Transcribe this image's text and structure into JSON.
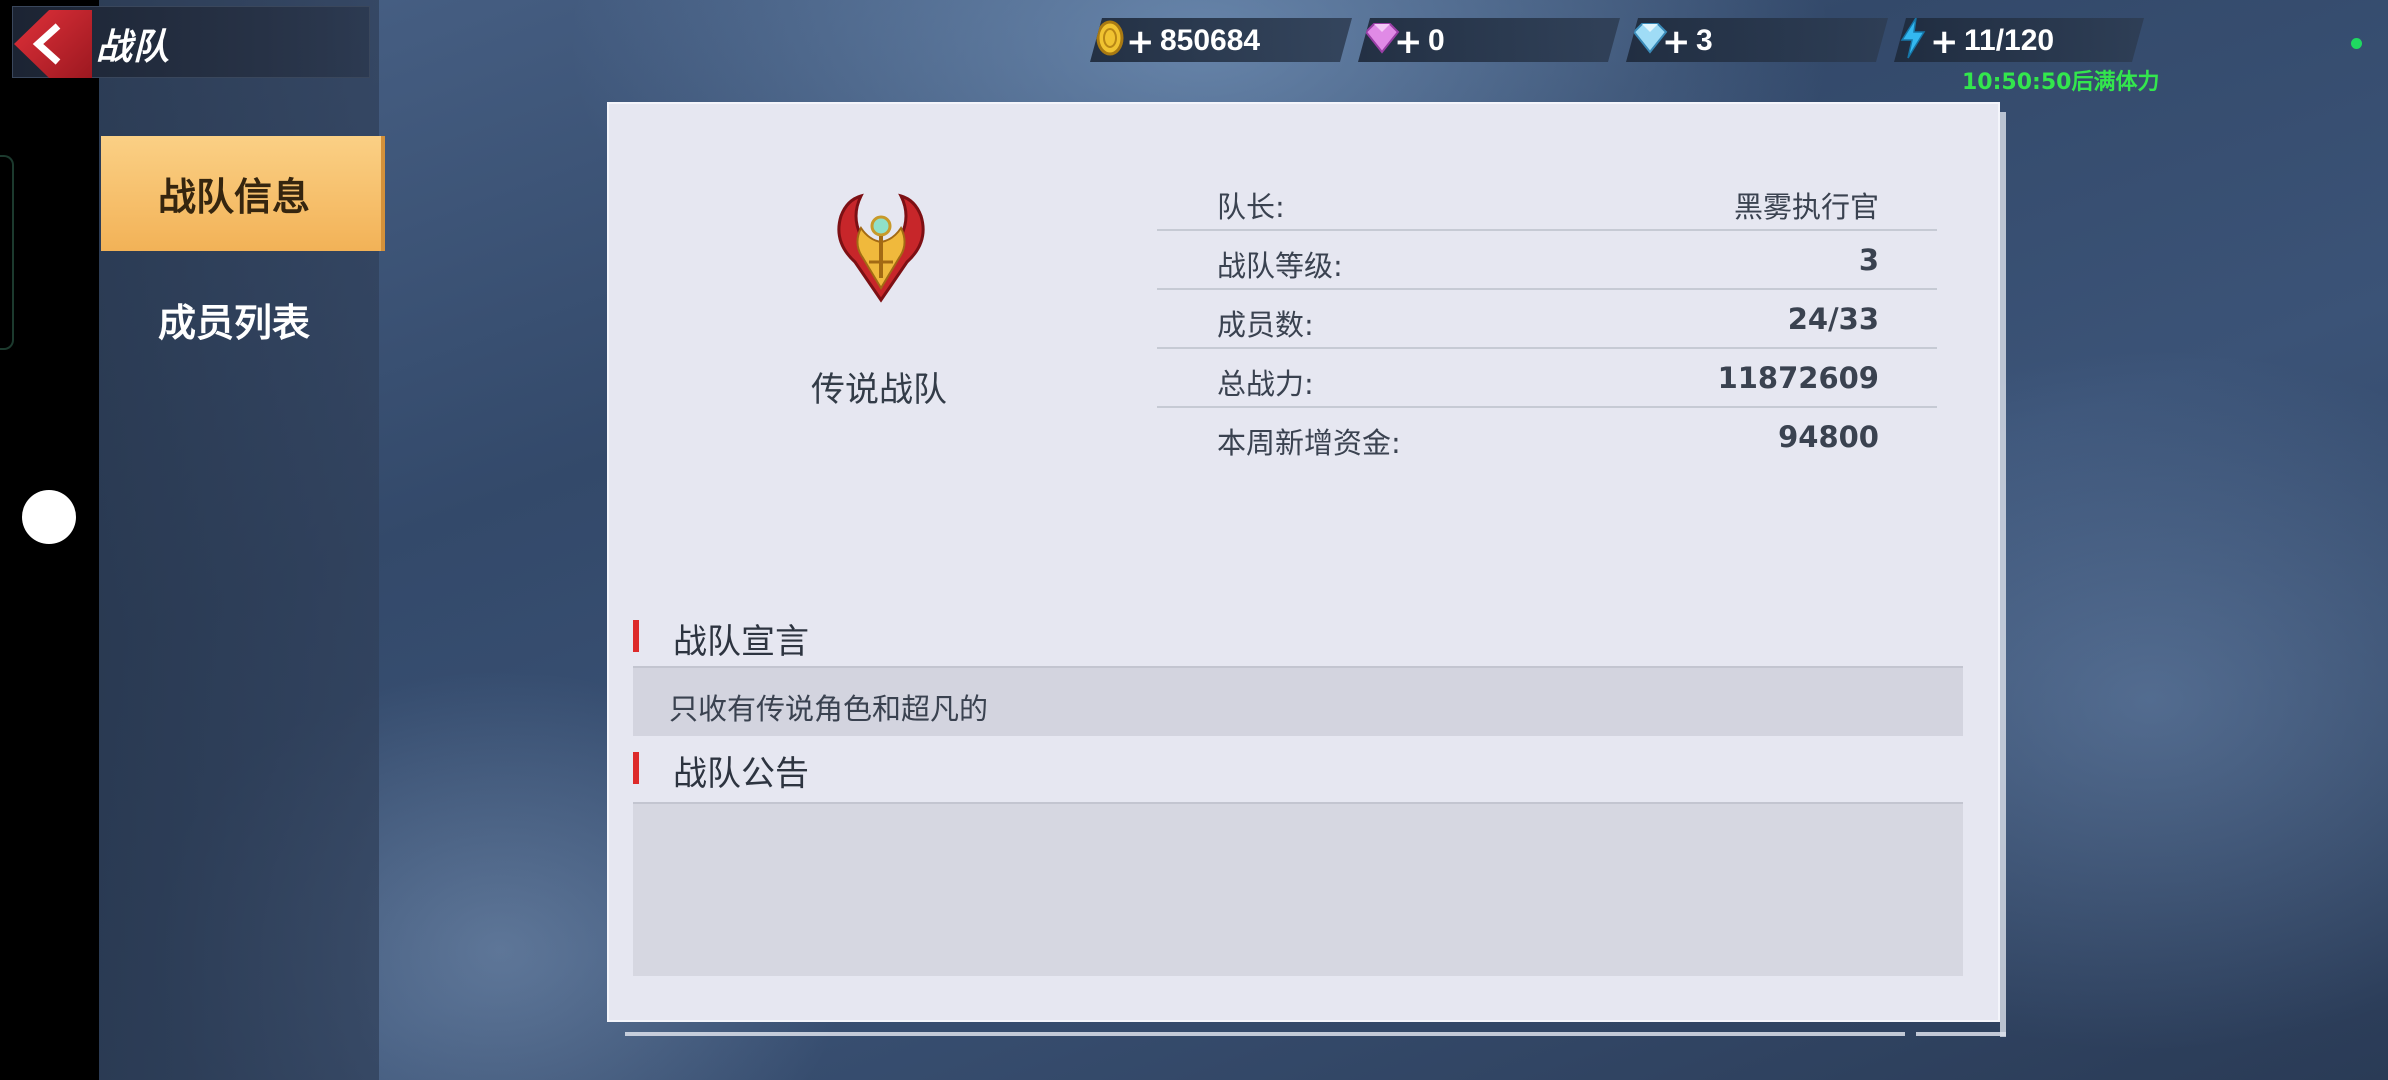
{
  "header": {
    "title": "战队"
  },
  "tabs": [
    {
      "label": "战队信息",
      "active": true
    },
    {
      "label": "成员列表",
      "active": false
    }
  ],
  "resources": {
    "gold": {
      "icon": "gold-coin-icon",
      "value": "850684"
    },
    "pink_gem": {
      "icon": "pink-diamond-icon",
      "value": "0"
    },
    "blue_gem": {
      "icon": "blue-diamond-icon",
      "value": "3"
    },
    "energy": {
      "icon": "lightning-icon",
      "value": "11/120"
    },
    "energy_timer": "10:50:50后满体力"
  },
  "team": {
    "name": "传说战队",
    "emblem": "team-emblem-icon",
    "info": [
      {
        "label": "队长:",
        "value": "黑雾执行官"
      },
      {
        "label": "战队等级:",
        "value": "3"
      },
      {
        "label": "成员数:",
        "value": "24/33"
      },
      {
        "label": "总战力:",
        "value": "11872609"
      },
      {
        "label": "本周新增资金:",
        "value": "94800"
      }
    ]
  },
  "sections": {
    "slogan_title": "战队宣言",
    "slogan_text": "只收有传说角色和超凡的",
    "notice_title": "战队公告",
    "notice_text": ""
  },
  "colors": {
    "active_tab": "#f2b257",
    "accent_red": "#dd2a2a",
    "timer_green": "#33e64d",
    "card_bg": "#e6e7f1"
  }
}
